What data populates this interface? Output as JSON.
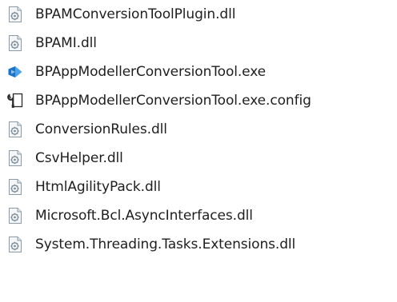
{
  "files": [
    {
      "name": "BPAMConversionToolPlugin.dll",
      "icon": "dll-file-icon"
    },
    {
      "name": "BPAMI.dll",
      "icon": "dll-file-icon"
    },
    {
      "name": "BPAppModellerConversionTool.exe",
      "icon": "application-exe-icon"
    },
    {
      "name": "BPAppModellerConversionTool.exe.config",
      "icon": "config-file-icon"
    },
    {
      "name": "ConversionRules.dll",
      "icon": "dll-file-icon"
    },
    {
      "name": "CsvHelper.dll",
      "icon": "dll-file-icon"
    },
    {
      "name": "HtmlAgilityPack.dll",
      "icon": "dll-file-icon"
    },
    {
      "name": "Microsoft.Bcl.AsyncInterfaces.dll",
      "icon": "dll-file-icon"
    },
    {
      "name": "System.Threading.Tasks.Extensions.dll",
      "icon": "dll-file-icon"
    }
  ],
  "colors": {
    "text": "#1e1e1e",
    "dll_page": "#f4f6f7",
    "dll_border": "#8a9aa6",
    "dll_gear": "#7f8f9b",
    "exe_blue": "#1a73c7",
    "exe_light": "#4aa3e8",
    "config_dark": "#2b2b2b"
  }
}
